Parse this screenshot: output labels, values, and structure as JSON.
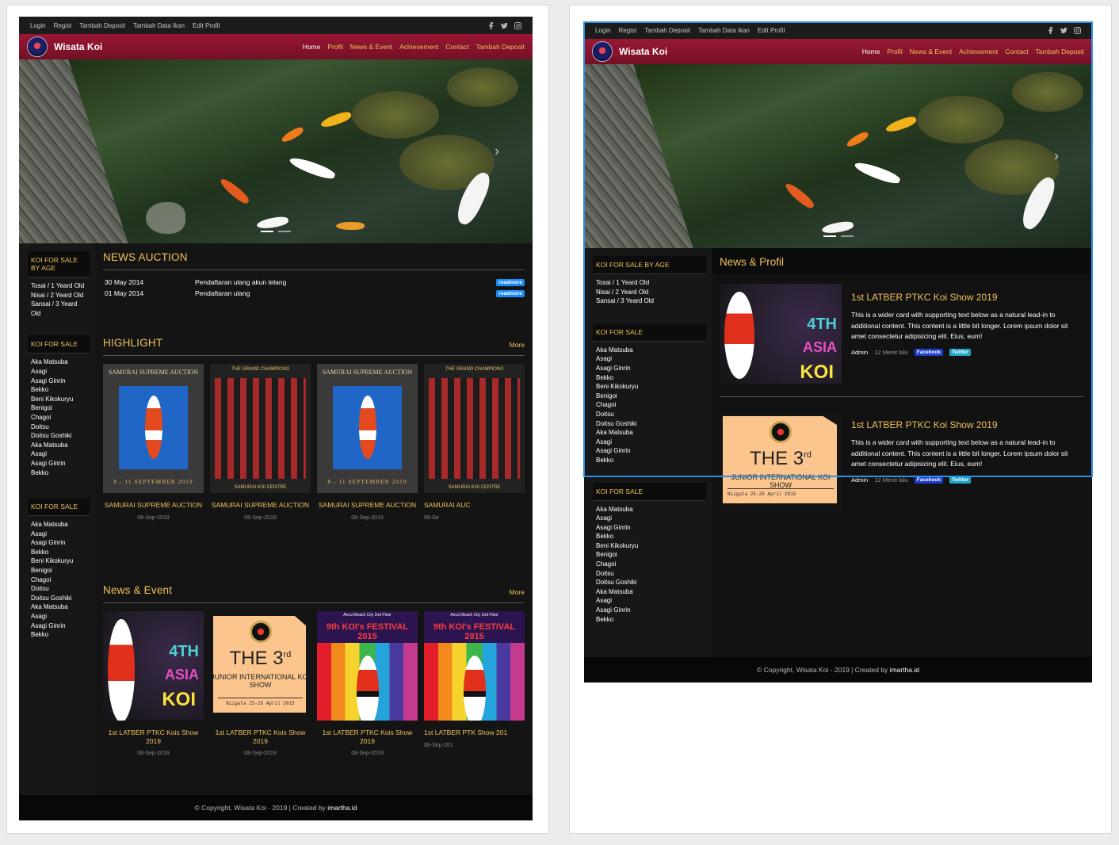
{
  "topbar": {
    "links": [
      "Login",
      "Regist",
      "Tambah Deposit",
      "Tambah Data Ikan",
      "Edit Profil"
    ]
  },
  "brand": "Wisata Koi",
  "nav": [
    "Home",
    "Profil",
    "News & Event",
    "Achievement",
    "Contact",
    "Tambah Deposit"
  ],
  "sidebar": {
    "by_age_title": "KOI FOR SALE BY AGE",
    "by_age": [
      "Tosai / 1 Yeard Old",
      "Nisai / 2 Yeard Old",
      "Sansai / 3 Yeard Old"
    ],
    "sale_title": "KOI FOR SALE",
    "sale": [
      "Aka Matsuba",
      "Asagi",
      "Asagi Ginrin",
      "Bekko",
      "Beni Kikokuryu",
      "Benigoi",
      "Chagoi",
      "Doitsu",
      "Doitsu Goshiki",
      "Aka Matsuba",
      "Asagi",
      "Asagi Ginrin",
      "Bekko"
    ]
  },
  "left": {
    "news_auction": {
      "title": "NEWS AUCTION",
      "rows": [
        {
          "date": "30 May 2014",
          "text": "Pendaftaran ulang akun lelang",
          "badge": "readmore"
        },
        {
          "date": "01 May 2014",
          "text": "Pendaftaran ulang",
          "badge": "readmore"
        }
      ]
    },
    "highlight": {
      "title": "HIGHLIGHT",
      "more": "More",
      "items": [
        {
          "title": "SAMURAI SUPREME AUCTION",
          "date": "08-Sep-2019"
        },
        {
          "title": "SAMURAI SUPREME AUCTION",
          "date": "08-Sep-2019"
        },
        {
          "title": "SAMURAI SUPREME AUCTION",
          "date": "08-Sep-2019"
        },
        {
          "title": "SAMURAI AUC",
          "date": "08-Se"
        }
      ],
      "poster": {
        "head": "SAMURAI SUPREME AUCTION",
        "foot": "8 - 11 SEPTEMBER 2019",
        "grid_head": "THE GRAND CHAMPIONS",
        "grid_foot": "SAMURAI KOI CENTRE"
      }
    },
    "news_event": {
      "title": "News & Event",
      "more": "More",
      "items": [
        {
          "title": "1st LATBER PTKC Kois Show 2019",
          "date": "08-Sep-2019"
        },
        {
          "title": "1st LATBER PTKC Kois Show 2019",
          "date": "08-Sep-2019"
        },
        {
          "title": "1st LATBER PTKC Kois Show 2019",
          "date": "08-Sep-2019"
        },
        {
          "title": "1st LATBER PTK Show 201",
          "date": "08-Sep-201"
        }
      ]
    }
  },
  "posters": {
    "asia": {
      "a": "4TH",
      "b": "ASIA",
      "c": "KOI"
    },
    "third": {
      "big": "THE 3",
      "sup": "rd",
      "sub": "JUNIOR INTERNATIONAL KOI SHOW",
      "date": "Niigata 25-26 April 2015"
    },
    "fest": {
      "head": "Ancol Beach City 2nd Floor",
      "title": "9th KOI's FESTIVAL 2015"
    }
  },
  "right": {
    "title": "News & Profil",
    "items": [
      {
        "title": "1st LATBER PTKC Koi Show 2019",
        "text": "This is a wider card with supporting text below as a natural lead-in to additional content. This content is a little bit longer. Lorem ipsum dolor sit amet consectetur adipisicing elit. Eius, eum!",
        "author": "Admin",
        "ago": "12 Menit lalu",
        "fb": "Facebook",
        "tw": "Twitter"
      },
      {
        "title": "1st LATBER PTKC Koi Show 2019",
        "text": "This is a wider card with supporting text below as a natural lead-in to additional content. This content is a little bit longer. Lorem ipsum dolor sit amet consectetur adipisicing elit. Eius, eum!",
        "author": "Admin",
        "ago": "12 Menit lalu",
        "fb": "Facebook",
        "tw": "Twitter"
      }
    ]
  },
  "footer": {
    "text": "© Copyright, Wisata Koi - 2019 | Created by ",
    "link": "imartha.id"
  }
}
